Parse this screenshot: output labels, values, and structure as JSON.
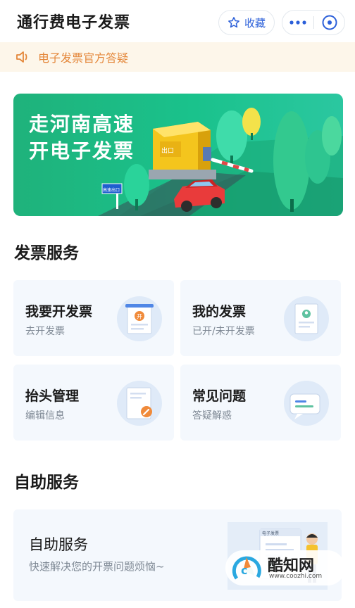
{
  "header": {
    "title": "通行费电子发票",
    "favorite_label": "收藏"
  },
  "notice": {
    "text": "电子发票官方答疑"
  },
  "banner": {
    "line1": "走河南高速",
    "line2": "开电子发票",
    "booth_sign": "出口",
    "road_sign": "高速出口"
  },
  "invoice_services": {
    "title": "发票服务",
    "cards": [
      {
        "title": "我要开发票",
        "subtitle": "去开发票",
        "icon_badge": "开"
      },
      {
        "title": "我的发票",
        "subtitle": "已开/未开发票"
      },
      {
        "title": "抬头管理",
        "subtitle": "编辑信息"
      },
      {
        "title": "常见问题",
        "subtitle": "答疑解惑"
      }
    ]
  },
  "self_service": {
    "title": "自助服务",
    "card_title": "自助服务",
    "card_subtitle": "快速解决您的开票问题烦恼~",
    "screen_label": "电子发票"
  },
  "watermark": {
    "name": "酷知网",
    "url": "www.coozhi.com"
  },
  "colors": {
    "accent_blue": "#2b5fd9",
    "notice_orange": "#e4873a",
    "banner_green": "#1fb27b",
    "card_bg": "#f4f8fd"
  }
}
